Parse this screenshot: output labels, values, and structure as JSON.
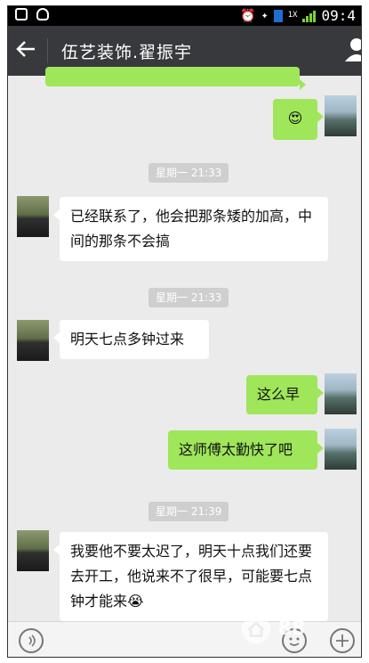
{
  "status_bar": {
    "network_label": "1X",
    "time": "09:4"
  },
  "header": {
    "title": "伍艺装饰.翟振宇"
  },
  "messages": [
    {
      "type": "outgoing",
      "text": "😍"
    },
    {
      "type": "timestamp",
      "text": "星期一 21:33"
    },
    {
      "type": "incoming",
      "text": "已经联系了，他会把那条矮的加高，中间的那条不会搞"
    },
    {
      "type": "timestamp",
      "text": "星期一 21:33"
    },
    {
      "type": "incoming",
      "text": "明天七点多钟过来"
    },
    {
      "type": "outgoing",
      "text": "这么早"
    },
    {
      "type": "outgoing",
      "text": "这师傅太勤快了吧"
    },
    {
      "type": "timestamp",
      "text": "星期一 21:39"
    },
    {
      "type": "incoming",
      "text": "我要他不要太迟了，明天十点我们还要去开工，他说来不了很早，可能要七点钟才能来😭"
    }
  ],
  "watermark": {
    "text": "88"
  },
  "colors": {
    "app_bar": "#38393d",
    "chat_bg": "#ebebeb",
    "outgoing_bubble": "#9fe65a",
    "incoming_bubble": "#ffffff",
    "timestamp_bg": "#cfcfcf"
  },
  "icons": [
    "back-arrow-icon",
    "person-icon",
    "voice-icon",
    "emoji-icon",
    "plus-icon",
    "home-icon"
  ]
}
